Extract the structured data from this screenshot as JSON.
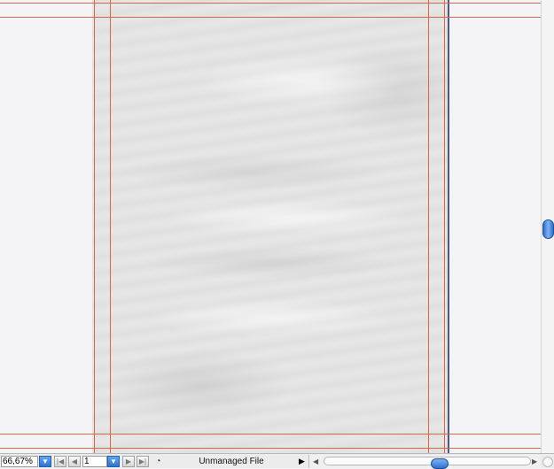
{
  "document": {
    "background": "crumpled-paper-texture",
    "guide_color": "#e0643e"
  },
  "statusbar": {
    "zoom_value": "66,67%",
    "zoom_dropdown_icon": "triangle-down-icon",
    "first_page_icon": "first-page-icon",
    "prev_page_icon": "previous-page-icon",
    "page_value": "1",
    "page_dropdown_icon": "triangle-down-icon",
    "next_page_icon": "next-page-icon",
    "last_page_icon": "last-page-icon",
    "status_icon": "version-cue-icon",
    "file_status": "Unmanaged File",
    "status_menu_icon": "triangle-right-icon"
  },
  "scrollbars": {
    "accent": "#2f6fd0"
  }
}
